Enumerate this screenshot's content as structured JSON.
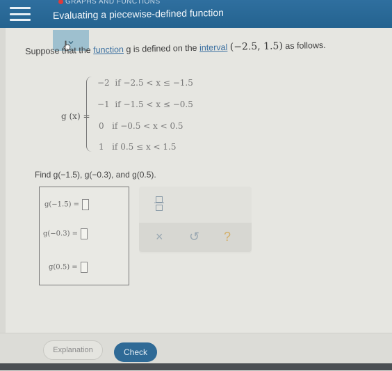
{
  "header": {
    "topic": "GRAPHS AND FUNCTIONS",
    "title": "Evaluating a piecewise-defined function"
  },
  "icons": {
    "menu": "hamburger-menu-icon",
    "collapse": "chevron-down-icon",
    "status_dot": "red-dot-icon"
  },
  "problem": {
    "prefix": "Suppose that the ",
    "link1": "function",
    "mid1": " g is defined on the ",
    "link2": "interval",
    "interval": "(−2.5,  1.5)",
    "suffix": " as follows."
  },
  "function_label": "g (x) =",
  "cases": [
    {
      "value": "−2",
      "condition": "if −2.5 < x ≤ −1.5"
    },
    {
      "value": "−1",
      "condition": "if −1.5 < x ≤ −0.5"
    },
    {
      "value": "0",
      "condition": "if −0.5 < x < 0.5"
    },
    {
      "value": "1",
      "condition": "if 0.5 ≤ x < 1.5"
    }
  ],
  "find_text": "Find g(−1.5), g(−0.3), and g(0.5).",
  "answers": [
    {
      "label": "g(−1.5) ="
    },
    {
      "label": "g(−0.3) ="
    },
    {
      "label": "g(0.5) ="
    }
  ],
  "tools": {
    "clear": "×",
    "undo": "↺",
    "help": "?"
  },
  "footer": {
    "explanation_label": "Explanation",
    "check_label": "Check"
  },
  "colors": {
    "header": "#2f6f9f",
    "check_button": "#2f6a96",
    "link": "#3a6fa0"
  }
}
